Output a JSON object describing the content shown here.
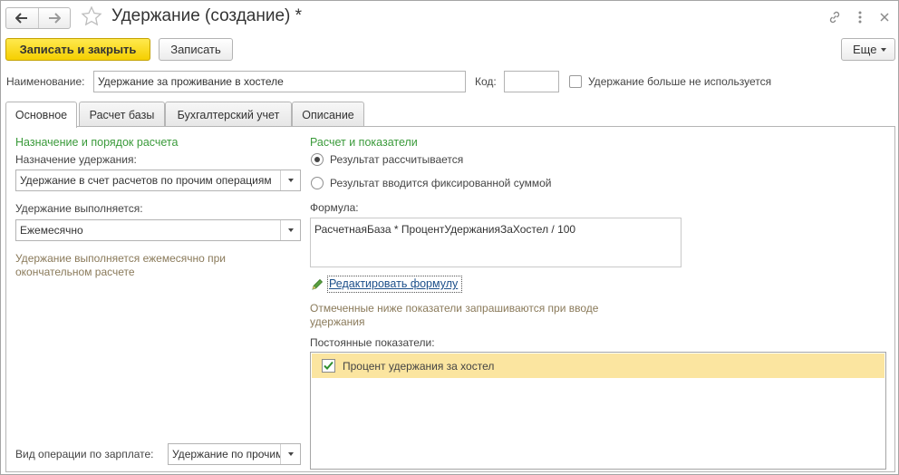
{
  "window": {
    "title": "Удержание (создание) *"
  },
  "toolbar": {
    "save_close_label": "Записать и закрыть",
    "save_label": "Записать",
    "more_label": "Еще"
  },
  "header": {
    "name_label": "Наименование:",
    "name_value": "Удержание за проживание в хостеле",
    "code_label": "Код:",
    "code_value": "",
    "unused_label": "Удержание больше не используется",
    "unused_checked": false
  },
  "tabs": [
    {
      "label": "Основное",
      "active": true
    },
    {
      "label": "Расчет базы",
      "active": false
    },
    {
      "label": "Бухгалтерский учет",
      "active": false
    },
    {
      "label": "Описание",
      "active": false
    }
  ],
  "left": {
    "section_title": "Назначение и порядок расчета",
    "purpose_label": "Назначение удержания:",
    "purpose_value": "Удержание в счет расчетов по прочим операциям",
    "schedule_label": "Удержание выполняется:",
    "schedule_value": "Ежемесячно",
    "hint": "Удержание выполняется ежемесячно при окончательном расчете",
    "operation_label": "Вид операции по зарплате:",
    "operation_value": "Удержание по прочим операциям"
  },
  "right": {
    "section_title": "Расчет и показатели",
    "radio_calculated": "Результат рассчитывается",
    "radio_fixed": "Результат вводится фиксированной суммой",
    "selected_radio": "calculated",
    "formula_label": "Формула:",
    "formula_value": "РасчетнаяБаза  * ПроцентУдержанияЗаХостел  / 100",
    "edit_formula_link": "Редактировать формулу",
    "indicators_hint": "Отмеченные ниже показатели запрашиваются при вводе удержания",
    "constant_indicators_label": "Постоянные показатели:",
    "indicators": [
      {
        "label": "Процент удержания за хостел",
        "checked": true
      }
    ]
  },
  "colors": {
    "primary_button": "#f5cf00",
    "section_title": "#3a9a3a",
    "hint_text": "#8a7a5a",
    "link": "#1c4f8a",
    "selected_row": "#fbe5a0"
  }
}
